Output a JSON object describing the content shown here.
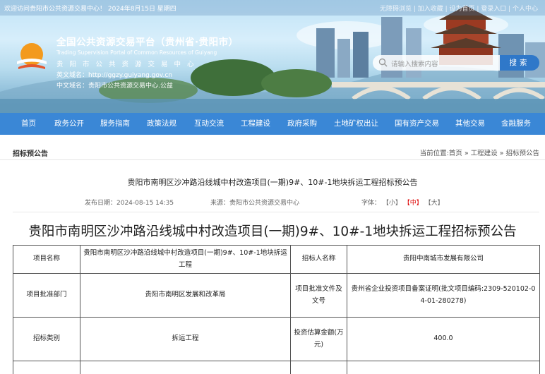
{
  "topbar": {
    "welcome": "欢迎访问贵阳市公共资源交易中心！ 2024年8月15日 星期四",
    "links": "无障碍浏览 | 加入收藏 | 设为首页 | 登录入口 | 个人中心"
  },
  "header": {
    "title_cn": "全国公共资源交易平台（贵州省·贵阳市）",
    "title_en": "Trading Supervision Portal of Common Resources of Guiyang",
    "org": "贵阳市公共资源交易中心",
    "domain_en_label": "英文域名：",
    "domain_en": "http://ggzy.guiyang.gov.cn",
    "domain_cn_label": "中文域名：",
    "domain_cn": "贵阳市公共资源交易中心.公益"
  },
  "search": {
    "placeholder": "请输入搜索内容",
    "button": "搜索"
  },
  "nav": {
    "items": [
      "首页",
      "政务公开",
      "服务指南",
      "政策法规",
      "互动交流",
      "工程建设",
      "政府采购",
      "土地矿权出让",
      "国有资产交易",
      "其他交易",
      "金融服务"
    ]
  },
  "section": {
    "name": "招标预公告",
    "breadcrumb": "当前位置:首页 » 工程建设 » 招标预公告"
  },
  "article": {
    "small_title": "贵阳市南明区沙冲路沿线城中村改造项目(一期)9#、10#-1地块拆运工程招标预公告",
    "publish_date": "发布日期：2024-08-15 14:35",
    "source": "来源：贵阳市公共资源交易中心",
    "font_label": "字体：",
    "font_small": "【小】",
    "font_medium": "【中】",
    "font_large": "【大】",
    "big_title": "贵阳市南明区沙冲路沿线城中村改造项目(一期)9#、10#-1地块拆运工程招标预公告"
  },
  "table": {
    "rows": [
      {
        "l1": "项目名称",
        "v1": "贵阳市南明区沙冲路沿线城中村改造项目(一期)9#、10#-1地块拆运工程",
        "l2": "招标人名称",
        "v2": "贵阳中南城市发展有限公司"
      },
      {
        "l1": "项目批准部门",
        "v1": "贵阳市南明区发展和改革局",
        "l2": "项目批准文件及文号",
        "v2": "贵州省企业投资项目备案证明(批文项目编码:2309-520102-04-01-280278)"
      },
      {
        "l1": "招标类别",
        "v1": "拆运工程",
        "l2": "投资估算金额(万元)",
        "v2": "400.0"
      }
    ]
  },
  "colors": {
    "nav": "#3a87d6",
    "search_button": "#2f78c9",
    "font_active": "#dd0000"
  }
}
